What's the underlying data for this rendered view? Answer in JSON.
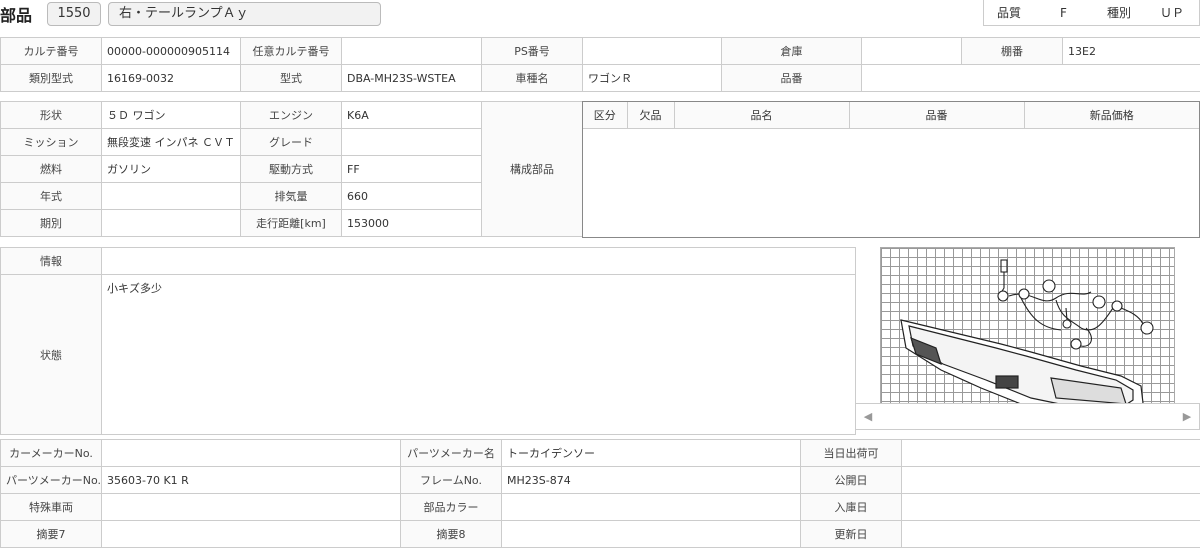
{
  "header": {
    "title": "部品",
    "part_no": "1550",
    "part_name": "右・テールランプＡｙ",
    "quality_label": "品質",
    "quality_value": "F",
    "type_label": "種別",
    "type_value": "ＵＰ"
  },
  "info1": {
    "karte_no_label": "カルテ番号",
    "karte_no": "00000-000000905114",
    "opt_karte_label": "任意カルテ番号",
    "opt_karte": "",
    "ps_label": "PS番号",
    "ps": "",
    "warehouse_label": "倉庫",
    "warehouse": "",
    "shelf_label": "棚番",
    "shelf": "13E2",
    "class_model_label": "類別型式",
    "class_model": "16169-0032",
    "model_label": "型式",
    "model": "DBA-MH23S-WSTEA",
    "car_name_label": "車種名",
    "car_name": "ワゴンＲ",
    "part_code_label": "品番",
    "part_code": ""
  },
  "spec": {
    "shape_label": "形状",
    "shape": "５Ｄ ワゴン",
    "engine_label": "エンジン",
    "engine": "K6A",
    "mission_label": "ミッション",
    "mission": "無段変速 インパネ ＣＶＴ",
    "grade_label": "グレード",
    "grade": "",
    "fuel_label": "燃料",
    "fuel": "ガソリン",
    "drive_label": "駆動方式",
    "drive": "FF",
    "year_label": "年式",
    "year": "",
    "displacement_label": "排気量",
    "displacement": "660",
    "period_label": "期別",
    "period": "",
    "mileage_label": "走行距離[km]",
    "mileage": "153000",
    "components_label": "構成部品"
  },
  "components_table": {
    "headers": [
      "区分",
      "欠品",
      "品名",
      "品番",
      "新品価格"
    ]
  },
  "notes": {
    "info_label": "情報",
    "info": "",
    "condition_label": "状態",
    "condition": "小キズ多少"
  },
  "bottom": {
    "car_maker_no_label": "カーメーカーNo.",
    "car_maker_no": "",
    "parts_maker_name_label": "パーツメーカー名",
    "parts_maker_name": "トーカイデンソー",
    "same_day_label": "当日出荷可",
    "same_day": "",
    "parts_maker_no_label": "パーツメーカーNo.",
    "parts_maker_no": "35603-70 K1 R",
    "frame_no_label": "フレームNo.",
    "frame_no": "MH23S-874",
    "publish_date_label": "公開日",
    "publish_date": "",
    "special_car_label": "特殊車両",
    "special_car": "",
    "part_color_label": "部品カラー",
    "part_color": "",
    "arrival_date_label": "入庫日",
    "arrival_date": "",
    "memo7_label": "摘要7",
    "memo7": "",
    "memo8_label": "摘要8",
    "memo8": "",
    "update_date_label": "更新日",
    "update_date": ""
  },
  "image": {
    "prev_icon": "chevron-left-icon",
    "next_icon": "chevron-right-icon"
  }
}
